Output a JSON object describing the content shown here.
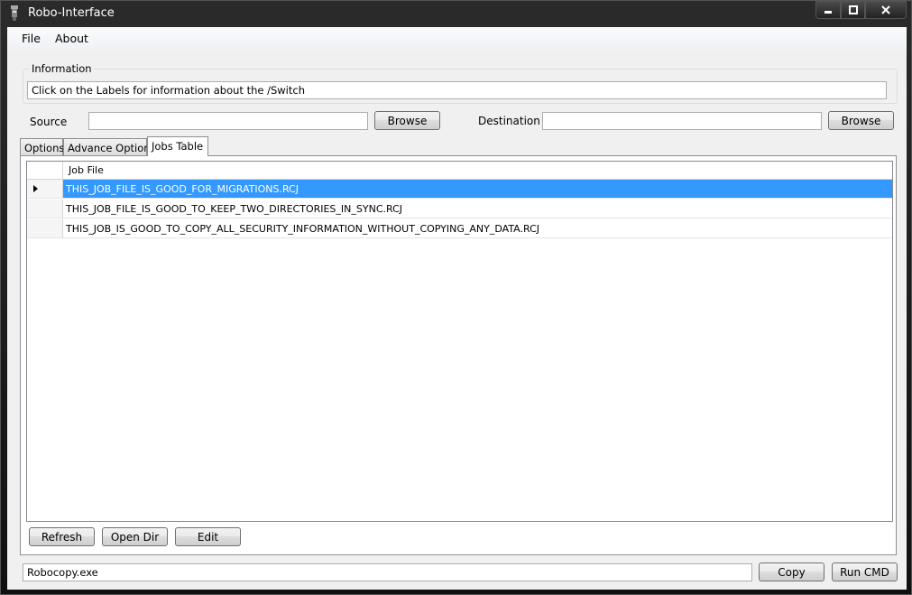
{
  "window": {
    "title": "Robo-Interface"
  },
  "menu": {
    "items": [
      "File",
      "About"
    ]
  },
  "information": {
    "legend": "Information",
    "text": "Click on the Labels for information about the /Switch"
  },
  "source": {
    "label": "Source",
    "value": "",
    "browse_label": "Browse"
  },
  "destination": {
    "label": "Destination",
    "value": "",
    "browse_label": "Browse"
  },
  "tabs": [
    {
      "label": "Options",
      "active": false
    },
    {
      "label": "Advance Options",
      "active": false
    },
    {
      "label": "Jobs Table",
      "active": true
    }
  ],
  "jobs_table": {
    "column_header": "Job File",
    "rows": [
      {
        "job_file": "THIS_JOB_FILE_IS_GOOD_FOR_MIGRATIONS.RCJ",
        "selected": true
      },
      {
        "job_file": "THIS_JOB_FILE_IS_GOOD_TO_KEEP_TWO_DIRECTORIES_IN_SYNC.RCJ",
        "selected": false
      },
      {
        "job_file": "THIS_JOB_IS_GOOD_TO_COPY_ALL_SECURITY_INFORMATION_WITHOUT_COPYING_ANY_DATA.RCJ",
        "selected": false
      }
    ]
  },
  "jobs_buttons": {
    "refresh": "Refresh",
    "open_dir": "Open Dir",
    "edit": "Edit"
  },
  "command": {
    "value": "Robocopy.exe",
    "copy_label": "Copy",
    "run_label": "Run CMD"
  },
  "colors": {
    "selection": "#3399ff",
    "titlebar": "#1a1a1a"
  }
}
